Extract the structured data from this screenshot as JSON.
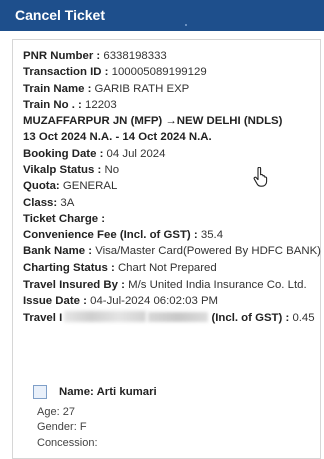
{
  "header": {
    "title": "Cancel Ticket"
  },
  "ticket": {
    "pnr_label": "PNR Number :",
    "pnr_value": "6338198333",
    "txn_label": "Transaction ID :",
    "txn_value": "100005089199129",
    "train_name_label": "Train Name :",
    "train_name_value": "GARIB RATH EXP",
    "train_no_label": "Train No . :",
    "train_no_value": "12203",
    "route": "MUZAFFARPUR JN (MFP) →NEW DELHI (NDLS)",
    "journey_dates": "13 Oct 2024 N.A. - 14 Oct 2024 N.A.",
    "booking_date_label": "Booking Date :",
    "booking_date_value": "04 Jul 2024",
    "vikalp_label": "Vikalp Status :",
    "vikalp_value": "No",
    "quota_label": "Quota:",
    "quota_value": "GENERAL",
    "class_label": "Class:",
    "class_value": "3A",
    "ticket_charge_label": "Ticket Charge :",
    "conv_fee_label": "Convenience Fee (Incl. of GST) :",
    "conv_fee_value": "35.4",
    "bank_label": "Bank Name :",
    "bank_value": "Visa/Master Card(Powered By HDFC BANK)",
    "charting_label": "Charting Status :",
    "charting_value": "Chart Not Prepared",
    "insured_label": "Travel Insured By :",
    "insured_value": "M/s United India Insurance Co. Ltd.",
    "issue_label": "Issue Date :",
    "issue_value": "04-Jul-2024 06:02:03 PM",
    "travel_ins_prefix": "Travel I",
    "travel_ins_suffix": "(Incl. of GST) :",
    "travel_ins_value": "0.45"
  },
  "passenger": {
    "name_label": "Name:",
    "name_value": "Arti kumari",
    "age_label": "Age:",
    "age_value": "27",
    "gender_label": "Gender:",
    "gender_value": "F",
    "concession_label": "Concession:"
  },
  "icons": {
    "cursor": "hand-pointer-icon",
    "checkbox": "checkbox-icon"
  },
  "colors": {
    "header_bg": "#1e4f8c",
    "checkbox_border": "#7f9fc8"
  }
}
